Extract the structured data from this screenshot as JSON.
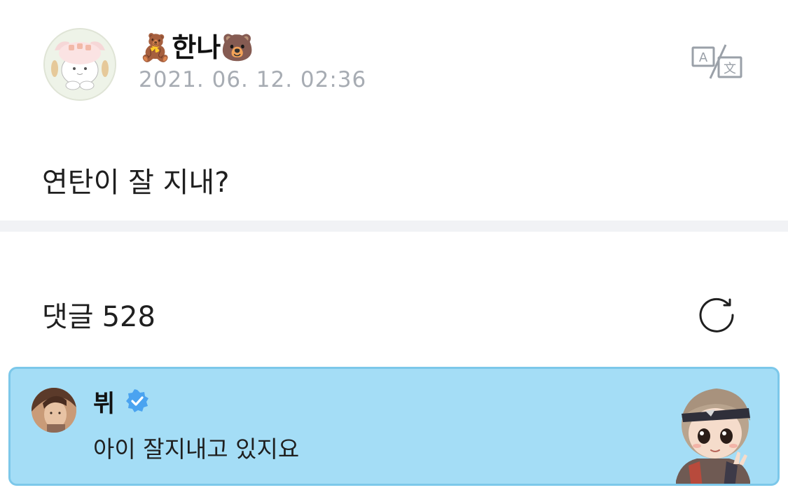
{
  "post": {
    "author_name": "🧸한나🐻",
    "timestamp": "2021. 06. 12. 02:36",
    "body": "연탄이 잘 지내?",
    "avatar_icon": "cartoon-character-avatar",
    "translate_icon": "translate-icon"
  },
  "comments": {
    "label": "댓글",
    "count": "528",
    "refresh_icon": "refresh-icon",
    "items": [
      {
        "author": "뷔",
        "verified": true,
        "text": "아이 잘지내고 있지요",
        "highlight_color": "#a4ddf6",
        "sticker_icon": "cartoon-sticker"
      }
    ]
  },
  "colors": {
    "accent_blue": "#4aa3f0",
    "timestamp_gray": "#a7acb3",
    "divider_gray": "#f1f2f5"
  }
}
